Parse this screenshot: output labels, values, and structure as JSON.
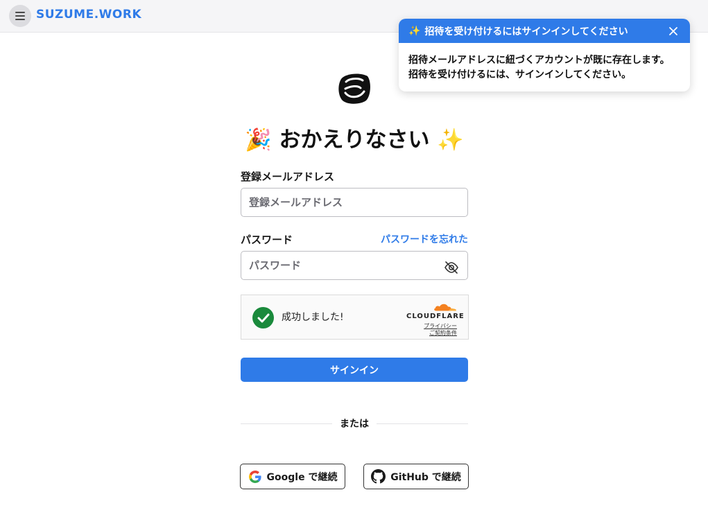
{
  "header": {
    "brand": "SUZUME.WORK",
    "menu_icon": "hamburger-menu-icon"
  },
  "toast": {
    "title_icon": "✨",
    "title": "招待を受け付けるにはサインインしてください",
    "body_line1": "招待メールアドレスに紐づくアカウントが既に存在します。",
    "body_line2": "招待を受け付けるには、サインインしてください。",
    "close_icon": "close-icon"
  },
  "form": {
    "logo_icon": "suzume-logo-icon",
    "welcome_left_emoji": "🎉",
    "welcome_text": "おかえりなさい",
    "welcome_right_emoji": "✨",
    "email_label": "登録メールアドレス",
    "email_placeholder": "登録メールアドレス",
    "email_value": "",
    "password_label": "パスワード",
    "forgot_password": "パスワードを忘れた",
    "password_placeholder": "パスワード",
    "password_value": "",
    "password_toggle_icon": "eye-slash-icon",
    "signin_label": "サインイン"
  },
  "captcha": {
    "status": "成功しました!",
    "provider": "CLOUDFLARE",
    "privacy": "プライバシー",
    "terms": "ご契約条件"
  },
  "divider": {
    "text": "または"
  },
  "oauth": {
    "google_label": "Google で継続",
    "github_label": "GitHub で継続"
  },
  "colors": {
    "accent": "#2f7be8",
    "success": "#1a8a3c",
    "cloudflare_orange": "#f48120"
  }
}
